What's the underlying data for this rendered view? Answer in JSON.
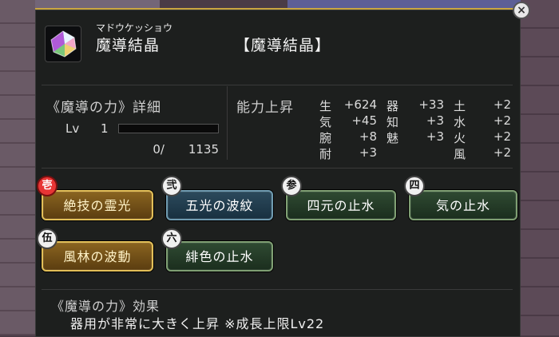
{
  "item": {
    "furigana": "マドウケッショウ",
    "name": "魔導結晶",
    "bracket_name": "【魔導結晶】"
  },
  "detail": {
    "title": "《魔導の力》詳細",
    "lv_label": "Lv",
    "lv_value": "1",
    "exp_current": "0/",
    "exp_max": "1135",
    "exp_progress": 0
  },
  "stats": {
    "title": "能力上昇",
    "rows": [
      {
        "label": "生",
        "value": "+624"
      },
      {
        "label": "器",
        "value": "+33"
      },
      {
        "label": "土",
        "value": "+2"
      },
      {
        "label": "気",
        "value": "+45"
      },
      {
        "label": "知",
        "value": "+3"
      },
      {
        "label": "水",
        "value": "+2"
      },
      {
        "label": "腕",
        "value": "+8"
      },
      {
        "label": "魅",
        "value": "+3"
      },
      {
        "label": "火",
        "value": "+2"
      },
      {
        "label": "耐",
        "value": "+3"
      },
      {
        "label": "風",
        "value": "+2"
      }
    ]
  },
  "skills": [
    {
      "badge": "壱",
      "label": "絶技の霊光",
      "style": "gold"
    },
    {
      "badge": "弐",
      "label": "五光の波紋",
      "style": "blue"
    },
    {
      "badge": "参",
      "label": "四元の止水",
      "style": "green"
    },
    {
      "badge": "四",
      "label": "気の止水",
      "style": "green"
    },
    {
      "badge": "伍",
      "label": "風林の波動",
      "style": "gold"
    },
    {
      "badge": "六",
      "label": "緋色の止水",
      "style": "green"
    }
  ],
  "effect": {
    "title": "《魔導の力》効果",
    "text": "器用が非常に大きく上昇 ※成長上限Lv22"
  },
  "colors": {
    "accent": "#c9a640",
    "badge_red": "#e73535",
    "panel_bg": "#1d1f1e"
  },
  "icons": {
    "close": "close-icon",
    "item": "crystal-icon"
  }
}
